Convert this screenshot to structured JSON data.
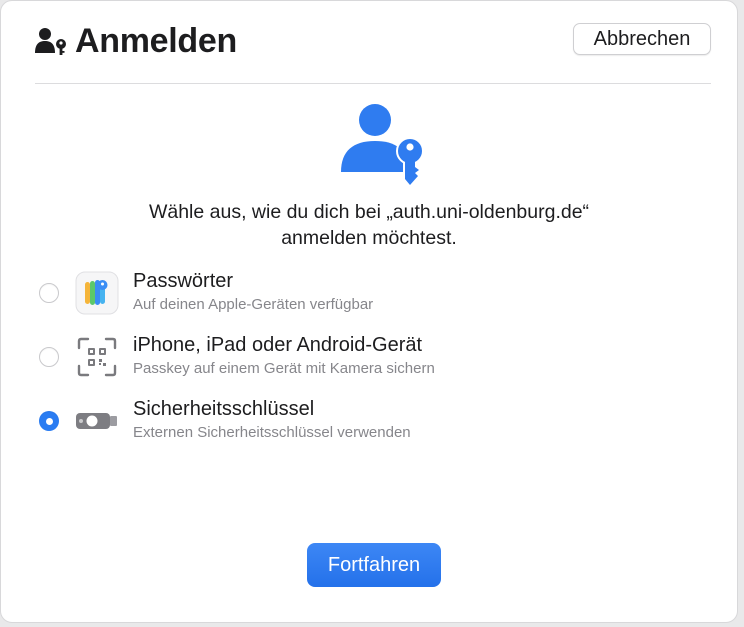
{
  "dialog": {
    "title": "Anmelden",
    "title_icon": "person-key-icon",
    "cancel_label": "Abbrechen",
    "hero_icon": "person-key-icon",
    "prompt_line1": "Wähle aus, wie du dich bei „auth.uni-oldenburg.de“",
    "prompt_line2": "anmelden möchtest.",
    "continue_label": "Fortfahren",
    "accent_color": "#2f7cf0"
  },
  "options": [
    {
      "title": "Passwörter",
      "subtitle": "Auf deinen Apple-Geräten verfügbar",
      "icon": "passwords-app-icon",
      "selected": false
    },
    {
      "title": "iPhone, iPad oder Android-Gerät",
      "subtitle": "Passkey auf einem Gerät mit Kamera sichern",
      "icon": "qr-code-scan-icon",
      "selected": false
    },
    {
      "title": "Sicherheitsschlüssel",
      "subtitle": "Externen Sicherheitsschlüssel verwenden",
      "icon": "security-key-icon",
      "selected": true
    }
  ]
}
